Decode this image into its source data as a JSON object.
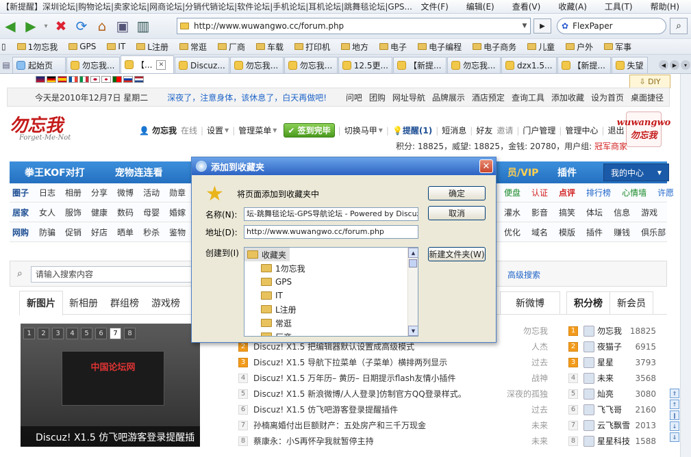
{
  "window": {
    "title": "【新提醒】深圳论坛|购物论坛|卖家论坛|网商论坛|分销代销论坛|软件论坛|手机论坛|耳机论坛|跳舞毯论坛|GPS...",
    "menus": [
      "文件(F)",
      "编辑(E)",
      "查看(V)",
      "收藏(A)",
      "工具(T)",
      "帮助(H)"
    ]
  },
  "address": {
    "url": "http://www.wuwangwo.cc/forum.php"
  },
  "search_box": {
    "engine": "FlexPaper"
  },
  "favorites": [
    "1勿忘我",
    "GPS",
    "IT",
    "L注册",
    "常逛",
    "厂商",
    "车载",
    "打印机",
    "地方",
    "电子",
    "电子编程",
    "电子商务",
    "儿童",
    "户外",
    "军事"
  ],
  "tabs": [
    {
      "label": "起始页"
    },
    {
      "label": "勿忘我..."
    },
    {
      "label": "【..."
    },
    {
      "label": "Discuz..."
    },
    {
      "label": "勿忘我..."
    },
    {
      "label": "勿忘我..."
    },
    {
      "label": "12.5更..."
    },
    {
      "label": "【新提..."
    },
    {
      "label": "勿忘我..."
    },
    {
      "label": "dzx1.5..."
    },
    {
      "label": "【新提..."
    },
    {
      "label": "失望"
    }
  ],
  "page": {
    "diy": "DIY",
    "date": "今天是2010年12月7日 星期二",
    "slogan": "深夜了，注意身体，该休息了，白天再做吧!",
    "toplinks": [
      "问吧",
      "团购",
      "网址导航",
      "品牌展示",
      "酒店预定",
      "查询工具",
      "添加收藏",
      "设为首页",
      "桌面捷径"
    ],
    "logo_text": "勿忘我",
    "logo_sub": "Forget-Me-Not",
    "logo_right": "wuwangwo\n勿忘我",
    "user": {
      "name": "勿忘我",
      "status": "在线",
      "settings": "设置",
      "manage": "管理菜单",
      "sign": "签到完毕",
      "switch": "切换马甲",
      "remind": "提醒(1)",
      "pm": "短消息",
      "friends": "好友",
      "invite": "邀请",
      "portal": "门户管理",
      "center": "管理中心",
      "logout": "退出"
    },
    "scores_prefix": "积分: 18825，威望: 18825，金钱: 20780，用户组: ",
    "scores_group": "冠军商家",
    "mainnav": [
      "拳王KOF对打",
      "宠物连连看"
    ],
    "mainnav_right": [
      "员/VIP",
      "插件"
    ],
    "mycenter": "我的中心",
    "subnav1": {
      "head": "圈子",
      "items": [
        "日志",
        "相册",
        "分享",
        "微博",
        "活动",
        "勋章"
      ],
      "right": [
        "便盘",
        "认证",
        "点评",
        "排行榜",
        "心情墙",
        "许愿"
      ]
    },
    "subnav2": {
      "head": "居家",
      "items": [
        "女人",
        "服饰",
        "健康",
        "数码",
        "母婴",
        "婚嫁"
      ],
      "right": [
        "灌水",
        "影音",
        "搞笑",
        "体坛",
        "信息",
        "游戏"
      ]
    },
    "subnav3": {
      "head": "网购",
      "items": [
        "防骗",
        "促销",
        "好店",
        "晒单",
        "秒杀",
        "鉴物"
      ],
      "right": [
        "优化",
        "域名",
        "模版",
        "插件",
        "赚钱",
        "俱乐部"
      ]
    },
    "search_placeholder": "请输入搜索内容",
    "advanced_search": "高级搜索",
    "content_tabs": [
      "新图片",
      "新相册",
      "群组榜",
      "游戏榜"
    ],
    "new_weibo": "新微博",
    "rank_tabs": [
      "积分榜",
      "新会员"
    ],
    "slider_nums": [
      "1",
      "2",
      "3",
      "4",
      "5",
      "6",
      "7",
      "8"
    ],
    "slider_caption": "Discuz! X1.5 仿飞吧游客登录提醒插",
    "slider_inner": "中国论坛网",
    "threads": [
      {
        "n": "1",
        "title": "",
        "author": "勿忘我"
      },
      {
        "n": "2",
        "title": "Discuz! X1.5 把编辑器默认设置成高级模式",
        "author": "人杰"
      },
      {
        "n": "3",
        "title": "Discuz! X1.5 导航下拉菜单（子菜单）横排两列显示",
        "author": "过去"
      },
      {
        "n": "4",
        "title": "Discuz! X1.5 万年历– 黄历– 日期提示flash友情小插件",
        "author": "战神"
      },
      {
        "n": "5",
        "title": "Discuz! X1.5 新浪微博/人人登录]仿制官方QQ登录样式。",
        "author": "深夜的孤独"
      },
      {
        "n": "6",
        "title": "Discuz! X1.5 仿飞吧游客登录提醒插件",
        "author": "过去"
      },
      {
        "n": "7",
        "title": "孙楠离婚付出巨额财产：五处房产和三千万现金",
        "author": "未来"
      },
      {
        "n": "8",
        "title": "蔡康永：小S再怀孕我就暂停主持",
        "author": "未来"
      }
    ],
    "ranks": [
      {
        "n": "1",
        "name": "勿忘我",
        "val": "18825"
      },
      {
        "n": "2",
        "name": "夜猫子",
        "val": "6915"
      },
      {
        "n": "3",
        "name": "星星",
        "val": "3793"
      },
      {
        "n": "4",
        "name": "未来",
        "val": "3568"
      },
      {
        "n": "5",
        "name": "灿亮",
        "val": "3080"
      },
      {
        "n": "6",
        "name": "飞飞哥",
        "val": "2160"
      },
      {
        "n": "7",
        "name": "云飞飘雪",
        "val": "2013"
      },
      {
        "n": "8",
        "name": "星星科技",
        "val": "1588"
      }
    ]
  },
  "dialog": {
    "title": "添加到收藏夹",
    "prompt": "将页面添加到收藏夹中",
    "name_label": "名称(N):",
    "name_value": "坛-跳舞毯论坛-GPS导航论坛 - Powered by Discuz!",
    "addr_label": "地址(D):",
    "addr_value": "http://www.wuwangwo.cc/forum.php",
    "create_label": "创建到(I)",
    "ok": "确定",
    "cancel": "取消",
    "new_folder": "新建文件夹(W)",
    "tree": [
      "收藏夹",
      "1勿忘我",
      "GPS",
      "IT",
      "L注册",
      "常逛",
      "厂商"
    ]
  },
  "colors": {
    "accent": "#2470c0",
    "red": "#d21d1d"
  }
}
